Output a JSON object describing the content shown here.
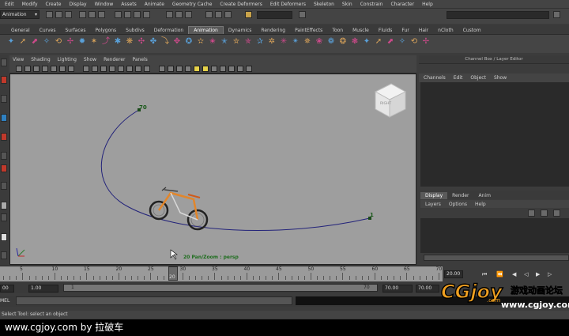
{
  "menubar": [
    "Edit",
    "Modify",
    "Create",
    "Display",
    "Window",
    "Assets",
    "Animate",
    "Geometry Cache",
    "Create Deformers",
    "Edit Deformers",
    "Skeleton",
    "Skin",
    "Constrain",
    "Character",
    "Help"
  ],
  "mode_selector": "Animation",
  "shelf_tabs": [
    "General",
    "Curves",
    "Surfaces",
    "Polygons",
    "Subdivs",
    "Deformation",
    "Animation",
    "Dynamics",
    "Rendering",
    "PaintEffects",
    "Toon",
    "Muscle",
    "Fluids",
    "Fur",
    "Hair",
    "nCloth",
    "Custom"
  ],
  "active_shelf_tab": "Animation",
  "viewport": {
    "menu": [
      "View",
      "Shading",
      "Lighting",
      "Show",
      "Renderer",
      "Panels"
    ],
    "frame_start_label": "1",
    "frame_end_label": "70",
    "status": "20 Pan/Zoom : persp",
    "viewcube_label": "RIGHT"
  },
  "channel_box": {
    "title": "Channel Box / Layer Editor",
    "menu": [
      "Channels",
      "Edit",
      "Object",
      "Show"
    ]
  },
  "layer_editor": {
    "tabs": [
      "Display",
      "Render",
      "Anim"
    ],
    "active_tab": "Display",
    "menu": [
      "Layers",
      "Options",
      "Help"
    ]
  },
  "time_slider": {
    "ticks": [
      "5",
      "10",
      "15",
      "20",
      "25",
      "30",
      "35",
      "40",
      "45",
      "50",
      "55",
      "60",
      "65",
      "70"
    ],
    "current_frame": "20",
    "current_time": "20.00"
  },
  "range_slider": {
    "start_field": "00",
    "anim_start": "1.00",
    "range_start": "1",
    "range_end": "70",
    "anim_end_field": "70.00",
    "range_end_field": "70.00"
  },
  "command_line": {
    "label": "MEL"
  },
  "help_line": "Select Tool: select an object",
  "footer": "www.cgjoy.com by 拉破车",
  "watermark": {
    "logo": "CGjoy",
    "suffix": ".com",
    "tagline": "游戏动画论坛",
    "url": "www.cgjoy.com"
  }
}
